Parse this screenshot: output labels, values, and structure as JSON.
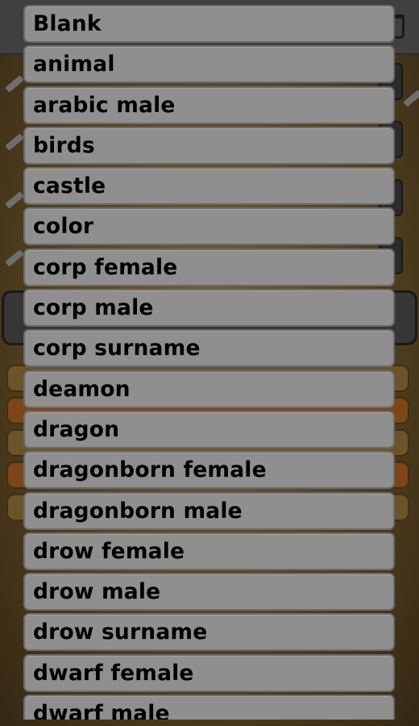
{
  "dropdown": {
    "items": [
      {
        "label": "Blank"
      },
      {
        "label": "animal"
      },
      {
        "label": "arabic male"
      },
      {
        "label": "birds"
      },
      {
        "label": "castle"
      },
      {
        "label": "color"
      },
      {
        "label": "corp female"
      },
      {
        "label": "corp male"
      },
      {
        "label": "corp surname"
      },
      {
        "label": "deamon"
      },
      {
        "label": "dragon"
      },
      {
        "label": "dragonborn female"
      },
      {
        "label": "dragonborn male"
      },
      {
        "label": "drow female"
      },
      {
        "label": "drow male"
      },
      {
        "label": "drow surname"
      },
      {
        "label": "dwarf female"
      },
      {
        "label": "dwarf male"
      }
    ]
  },
  "background_icons": [
    "trash-icon",
    "pencil-icon"
  ],
  "colors": {
    "item_background": "#8f8f8f",
    "item_border": "#6a6a6a",
    "item_text": "#000000",
    "app_background": "#9c7a3a",
    "chip_orange": "#d9772a",
    "chip_tan": "#b89245"
  }
}
